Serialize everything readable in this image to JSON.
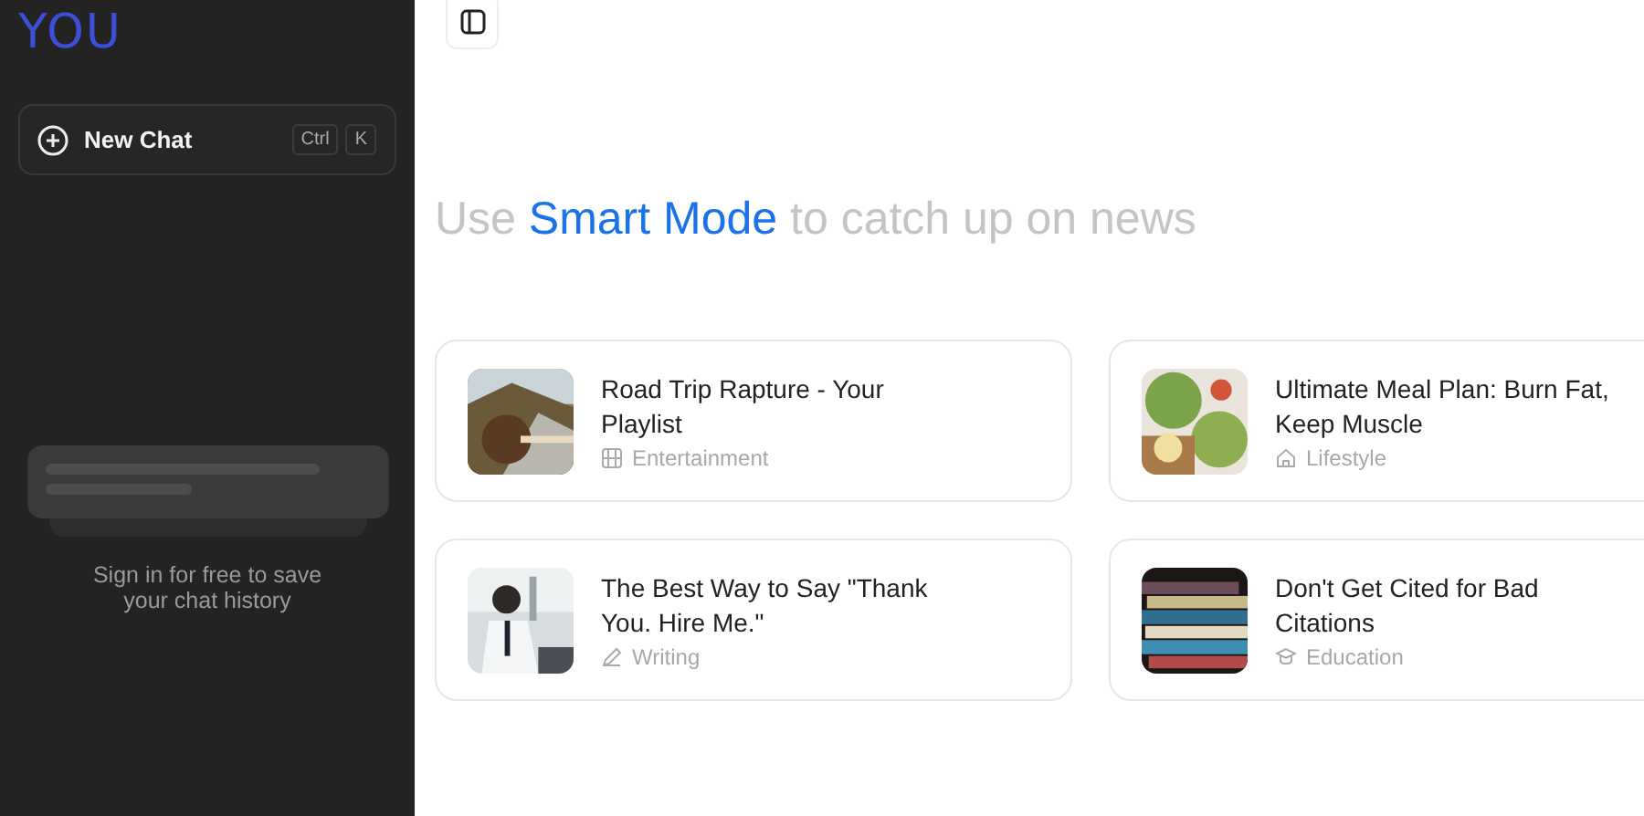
{
  "sidebar": {
    "logo": "YOU",
    "new_chat": {
      "label": "New Chat",
      "shortcut": [
        "Ctrl",
        "K"
      ]
    },
    "sign_in_note": "Sign in for free to save your chat history"
  },
  "heading": {
    "before": "Use",
    "highlight": "Smart Mode",
    "after": "to catch up on news"
  },
  "cards": [
    {
      "title": "Road Trip Rapture - Your Playlist",
      "category": "Entertainment"
    },
    {
      "title": "Ultimate Meal Plan: Burn Fat, Keep Muscle",
      "category": "Lifestyle"
    },
    {
      "title": "The Best Way to Say \"Thank You. Hire Me.\"",
      "category": "Writing"
    },
    {
      "title": "Don't Get Cited for Bad Citations",
      "category": "Education"
    }
  ]
}
